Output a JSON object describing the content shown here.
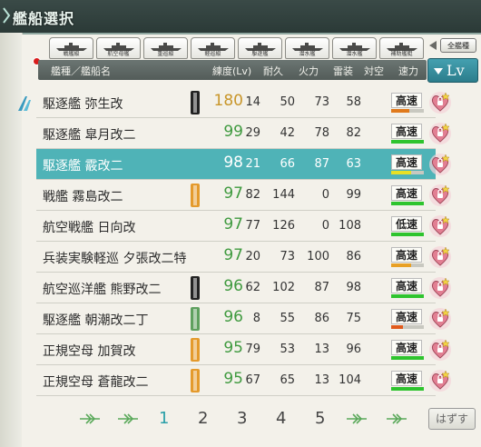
{
  "window": {
    "title": "艦船選択"
  },
  "filter_tabs": [
    {
      "label": "戦艦級"
    },
    {
      "label": "航空母艦"
    },
    {
      "label": "重巡級"
    },
    {
      "label": "軽巡級"
    },
    {
      "label": "駆逐艦"
    },
    {
      "label": "潜水艦"
    },
    {
      "label": "潜水艦"
    },
    {
      "label": "補助艦艇"
    }
  ],
  "all_button": {
    "label": "全艦種"
  },
  "header": {
    "type_name": "艦種／艦船名",
    "level": "練度(Lv)",
    "hp": "耐久",
    "firepower": "火力",
    "torpedo": "雷装",
    "aa": "対空",
    "speed": "速力"
  },
  "sort": {
    "label": "Lv"
  },
  "rows": [
    {
      "name": "駆逐艦 弥生改",
      "lv": "180",
      "hp": "14",
      "fp": "50",
      "tp": "73",
      "aa": "58",
      "speed": "高速",
      "bar": 0.55,
      "bar_color": "#e07a1c",
      "selected": false,
      "badge": "black",
      "lv_color": "#c8962a"
    },
    {
      "name": "駆逐艦 皐月改二",
      "lv": "99",
      "hp": "29",
      "fp": "42",
      "tp": "78",
      "aa": "82",
      "speed": "高速",
      "bar": 1.0,
      "bar_color": "#2ec42e",
      "selected": false,
      "badge": "",
      "lv_color": "#3f9a3f"
    },
    {
      "name": "駆逐艦 霰改二",
      "lv": "98",
      "hp": "21",
      "fp": "66",
      "tp": "87",
      "aa": "63",
      "speed": "高速",
      "bar": 0.6,
      "bar_color": "#e8e025",
      "selected": true,
      "badge": "",
      "lv_color": "#ffffff"
    },
    {
      "name": "戦艦 霧島改二",
      "lv": "97",
      "hp": "82",
      "fp": "144",
      "tp": "0",
      "aa": "99",
      "speed": "高速",
      "bar": 1.0,
      "bar_color": "#2ec42e",
      "selected": false,
      "badge": "orange",
      "lv_color": "#3f9a3f"
    },
    {
      "name": "航空戦艦 日向改",
      "lv": "97",
      "hp": "77",
      "fp": "126",
      "tp": "0",
      "aa": "108",
      "speed": "低速",
      "bar": 1.0,
      "bar_color": "#2ec42e",
      "selected": false,
      "badge": "",
      "lv_color": "#3f9a3f"
    },
    {
      "name": "兵装実験軽巡 夕張改二特",
      "lv": "97",
      "hp": "20",
      "fp": "73",
      "tp": "100",
      "aa": "86",
      "speed": "高速",
      "bar": 0.6,
      "bar_color": "#e8a025",
      "selected": false,
      "badge": "",
      "lv_color": "#3f9a3f"
    },
    {
      "name": "航空巡洋艦 熊野改二",
      "lv": "96",
      "hp": "62",
      "fp": "102",
      "tp": "87",
      "aa": "98",
      "speed": "高速",
      "bar": 1.0,
      "bar_color": "#2ec42e",
      "selected": false,
      "badge": "black",
      "lv_color": "#3f9a3f"
    },
    {
      "name": "駆逐艦 朝潮改二丁",
      "lv": "96",
      "hp": "8",
      "fp": "55",
      "tp": "86",
      "aa": "75",
      "speed": "高速",
      "bar": 0.35,
      "bar_color": "#e05a1c",
      "selected": false,
      "badge": "green",
      "lv_color": "#3f9a3f"
    },
    {
      "name": "正規空母 加賀改",
      "lv": "95",
      "hp": "79",
      "fp": "53",
      "tp": "13",
      "aa": "96",
      "speed": "高速",
      "bar": 1.0,
      "bar_color": "#2ec42e",
      "selected": false,
      "badge": "orange",
      "lv_color": "#3f9a3f"
    },
    {
      "name": "正規空母 蒼龍改二",
      "lv": "95",
      "hp": "67",
      "fp": "65",
      "tp": "13",
      "aa": "104",
      "speed": "高速",
      "bar": 1.0,
      "bar_color": "#2ec42e",
      "selected": false,
      "badge": "orange",
      "lv_color": "#3f9a3f"
    }
  ],
  "pager": {
    "pages": [
      "1",
      "2",
      "3",
      "4",
      "5"
    ],
    "current": "1"
  },
  "remove_button": {
    "label": "はずす"
  },
  "colors": {
    "accent": "#4fb3b7",
    "level_green": "#3f9a3f",
    "title_bg": "#2b3a37"
  }
}
